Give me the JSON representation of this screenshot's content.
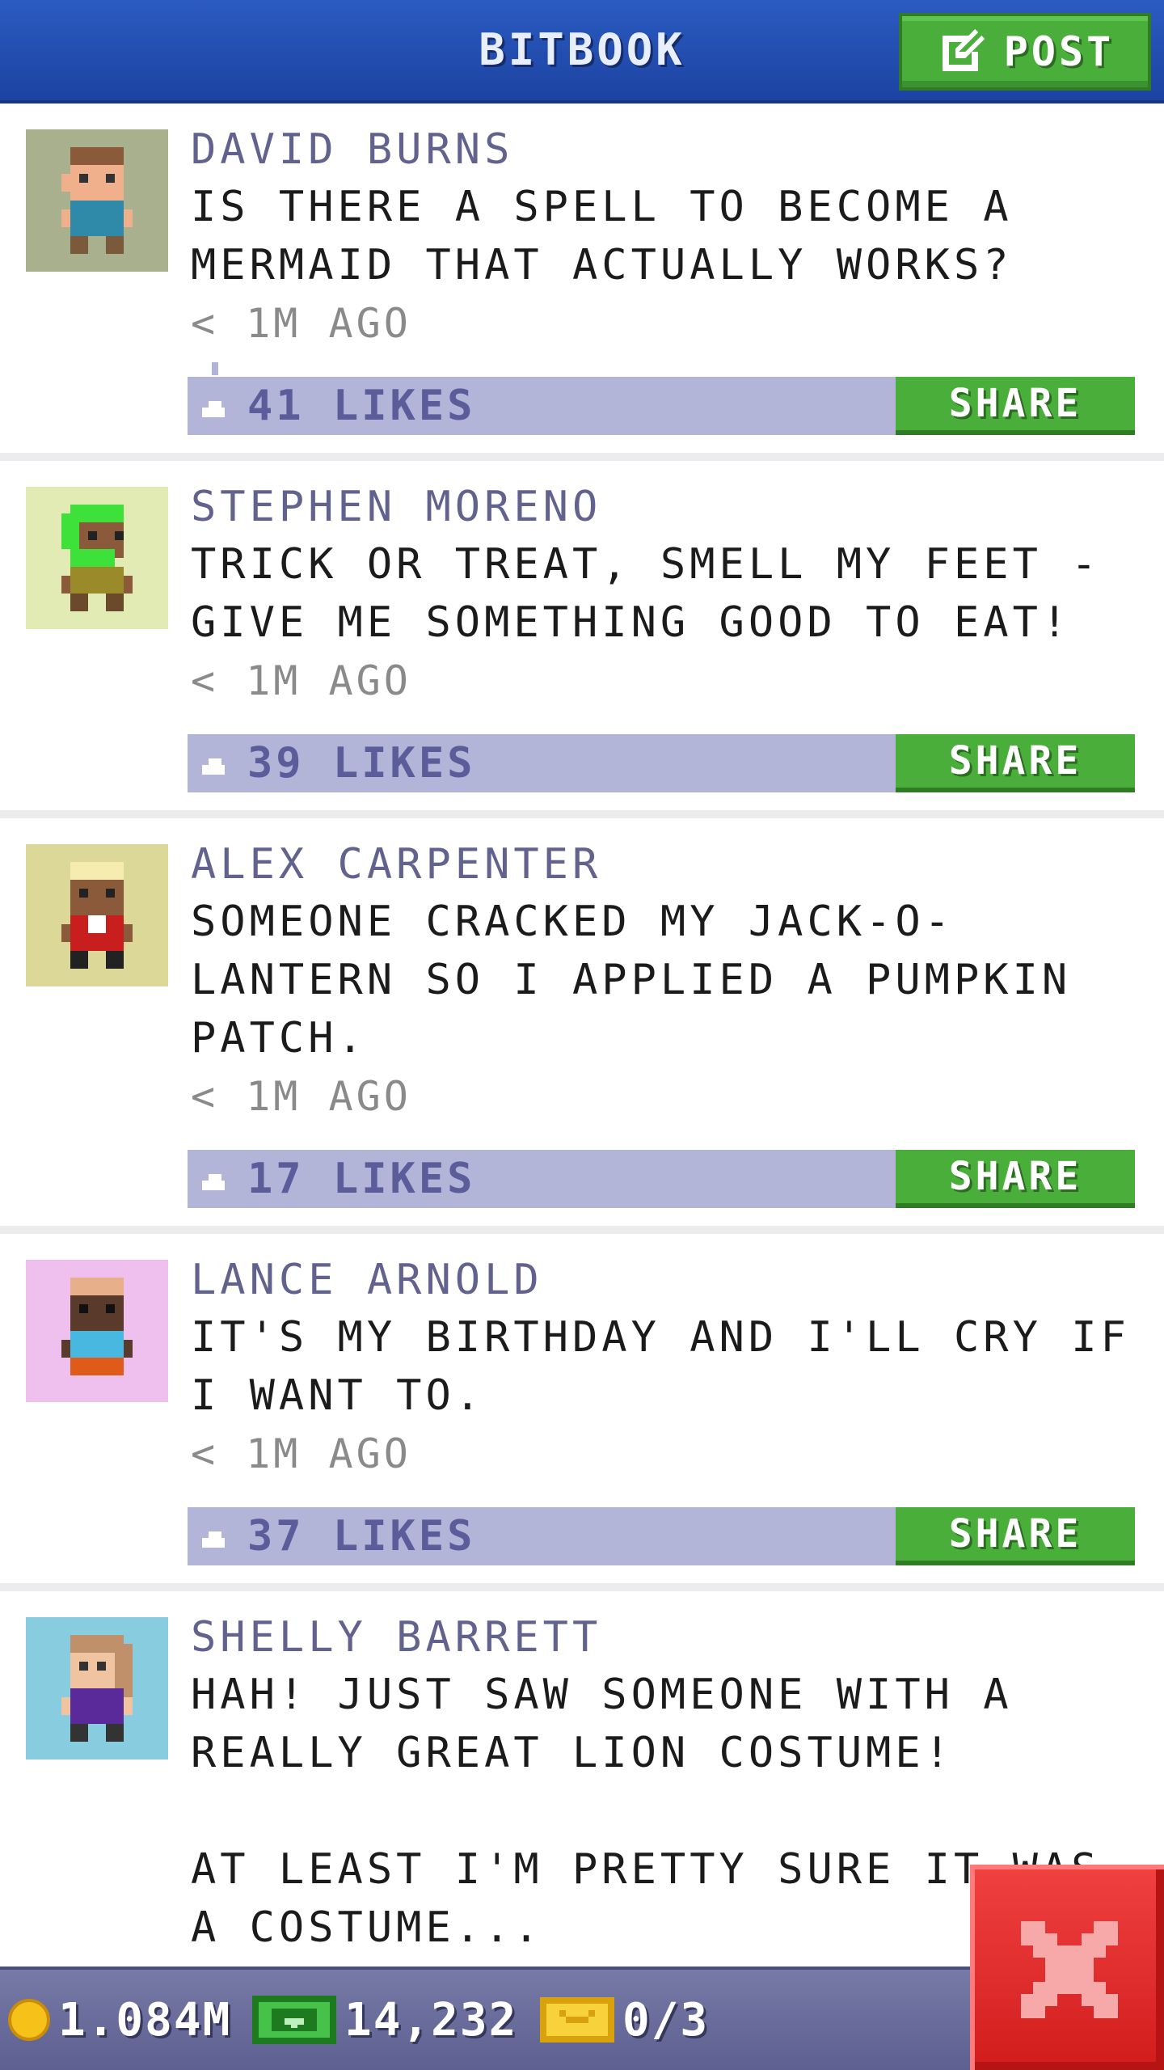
{
  "header": {
    "title": "BITBOOK",
    "post_label": "POST"
  },
  "posts": [
    {
      "author": "DAVID BURNS",
      "message": "IS THERE A SPELL TO BECOME A MERMAID THAT ACTUALLY WORKS?",
      "time": "< 1M AGO",
      "likes": "41 LIKES",
      "share_label": "SHARE",
      "avatar_bg": "#a8b08e"
    },
    {
      "author": "STEPHEN MORENO",
      "message": "TRICK OR TREAT, SMELL MY FEET - GIVE ME SOMETHING GOOD TO EAT!",
      "time": "< 1M AGO",
      "likes": "39 LIKES",
      "share_label": "SHARE",
      "avatar_bg": "#e3ebb4"
    },
    {
      "author": "ALEX CARPENTER",
      "message": "SOMEONE CRACKED MY JACK-O-LANTERN SO I APPLIED A PUMPKIN PATCH.",
      "time": "< 1M AGO",
      "likes": "17 LIKES",
      "share_label": "SHARE",
      "avatar_bg": "#dcd898"
    },
    {
      "author": "LANCE ARNOLD",
      "message": "IT'S MY BIRTHDAY AND I'LL CRY IF I WANT TO.",
      "time": "< 1M AGO",
      "likes": "37 LIKES",
      "share_label": "SHARE",
      "avatar_bg": "#efc0ee"
    },
    {
      "author": "SHELLY BARRETT",
      "message": "HAH! JUST SAW SOMEONE WITH A REALLY GREAT LION COSTUME!\n\nAT LEAST I'M PRETTY SURE IT WAS A COSTUME...",
      "time": "< 1M AGO",
      "avatar_bg": "#88cce0"
    }
  ],
  "footer": {
    "coins": "1.084M",
    "bux": "14,232",
    "tickets": "0/3"
  },
  "colors": {
    "header_blue": "#2452b6",
    "accent_green": "#4aae3a",
    "like_bar": "#b2b4d8",
    "author_purple": "#62628e",
    "close_red": "#e02a2a"
  },
  "icons": [
    "edit-icon",
    "like-icon",
    "coin-icon",
    "bux-icon",
    "ticket-icon",
    "close-icon"
  ]
}
